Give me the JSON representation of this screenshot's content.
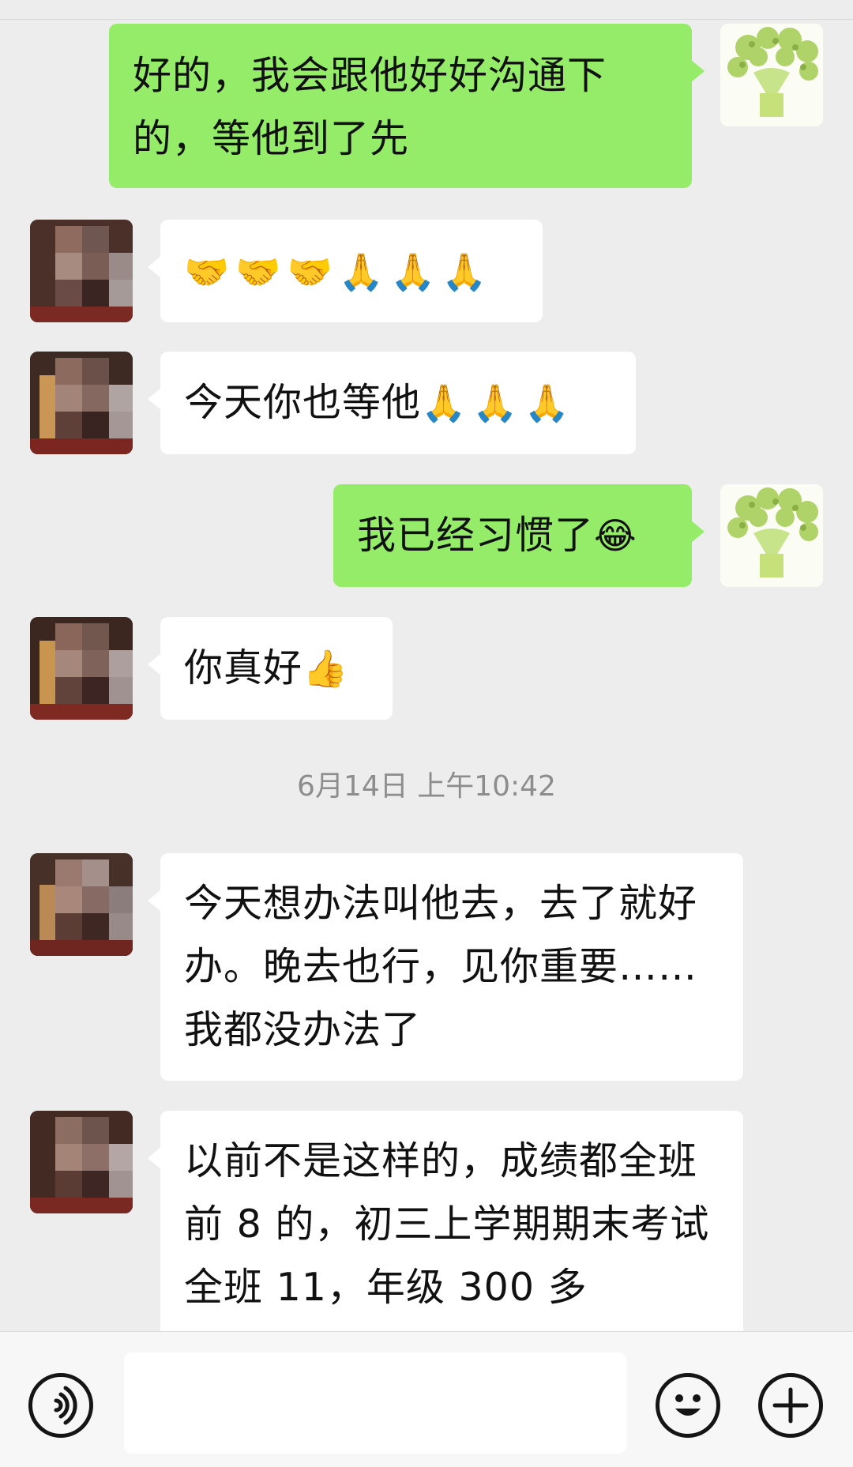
{
  "messages": [
    {
      "from": "me",
      "text": "好的，我会跟他好好沟通下的，等他到了先"
    },
    {
      "from": "them",
      "text": "",
      "emoji": "🤝🤝🤝🙏🙏🙏"
    },
    {
      "from": "them",
      "text": "今天你也等他",
      "emoji": "🙏🙏🙏"
    },
    {
      "from": "me",
      "text": "我已经习惯了",
      "emoji": "😂"
    },
    {
      "from": "them",
      "text": "你真好",
      "emoji": "👍"
    },
    {
      "from": "them",
      "text": "今天想办法叫他去，去了就好办。晚去也行，见你重要……我都没办法了"
    },
    {
      "from": "them",
      "text": "以前不是这样的，成绩都全班前 8 的，初三上学期期末考试全班 11，年级 300 多"
    }
  ],
  "timestamp": "6月14日 上午10:42",
  "input": {
    "value": "",
    "placeholder": ""
  },
  "icons": {
    "voice": "voice-icon",
    "emoji": "smiley-icon",
    "more": "plus-icon"
  },
  "colors": {
    "me_bubble": "#95ec69",
    "them_bubble": "#ffffff",
    "background": "#ededed"
  }
}
